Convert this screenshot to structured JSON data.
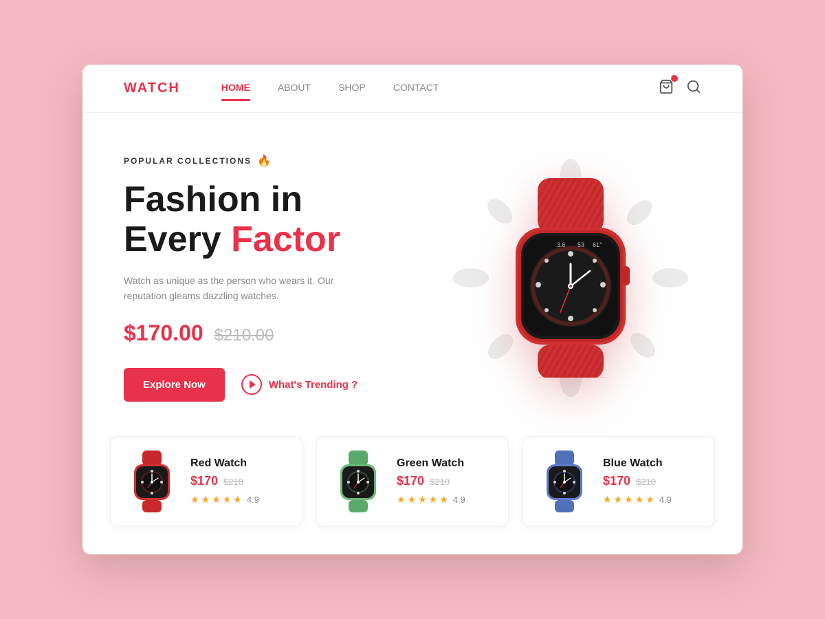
{
  "brand": "WATCH",
  "nav": {
    "links": [
      {
        "label": "HOME",
        "active": true
      },
      {
        "label": "ABOUT",
        "active": false
      },
      {
        "label": "SHOP",
        "active": false
      },
      {
        "label": "CONTACT",
        "active": false
      }
    ]
  },
  "hero": {
    "badge": "POPULAR COLLECTIONS",
    "badge_icon": "🔥",
    "title_line1": "Fashion in",
    "title_line2_normal": "Every ",
    "title_line2_highlight": "Factor",
    "description": "Watch as unique as the person who wears it. Our reputation gleams dazzling watches.",
    "price_current": "$170.00",
    "price_original": "$210.00",
    "btn_explore": "Explore Now",
    "btn_trending": "What's Trending ?"
  },
  "products": [
    {
      "name": "Red Watch",
      "price_current": "$170",
      "price_old": "$210",
      "rating": "4.9",
      "color": "red",
      "band_color": "#d13030"
    },
    {
      "name": "Green Watch",
      "price_current": "$170",
      "price_old": "$210",
      "rating": "4.9",
      "color": "green",
      "band_color": "#5db87a"
    },
    {
      "name": "Blue Watch",
      "price_current": "$170",
      "price_old": "$210",
      "rating": "4.9",
      "color": "blue",
      "band_color": "#5a7cb8"
    }
  ],
  "colors": {
    "accent": "#e8314a",
    "star": "#f5a623"
  }
}
